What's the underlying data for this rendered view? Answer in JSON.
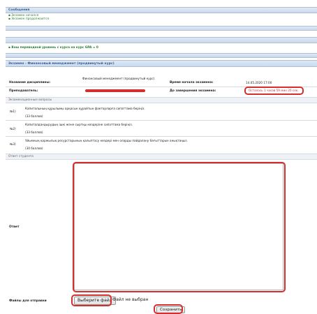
{
  "messages": {
    "title": "Сообщения",
    "items": [
      "Экзамен начался",
      "Экзамен продолжается"
    ]
  },
  "transfer": {
    "text": "Ваш переводной уровень с курса на курс GPA = 0"
  },
  "exam": {
    "title": "Экзамен - Финансовый менеджмент (продвинутый курс)",
    "discipline_label": "Название дисциплины:",
    "discipline_value": "Финансовый менеджмент (продвинутый курс)",
    "start_label": "Время начала экзамена:",
    "start_value": "14.05.2020 17:00",
    "teacher_label": "Преподаватель:",
    "remaining_label": "До завершения экзамена:",
    "remaining_value": "Осталось 1 часов 59 мин 20 сек.",
    "questions_title": "Экзаменационные вопросы",
    "questions": [
      {
        "num": "№1)",
        "text": "Капиталының құрылымы арқасын құрайтын факторларға сипаттама беріңіз.",
        "score": "(33 баллов)"
      },
      {
        "num": "№2)",
        "text": "Капиталдандырудың ішкі және сыртқы көздеріне сипаттама беріңіз.",
        "score": "(33 баллов)"
      },
      {
        "num": "№3)",
        "text": "Ұйымның қаржылық ресурстарының қалыптасу көздері мен оларды пайдалану бағыттарын анықтаңыз.",
        "score": "(34 баллов)"
      }
    ],
    "answer_title": "Ответ студента",
    "answer_label": "Ответ",
    "files_label": "Файлы для отправки",
    "choose_file": "Выберите файл",
    "no_file": "Файл не выбран",
    "save": "Сохранить"
  },
  "colors": {
    "accent": "#365f91",
    "message": "#2e7d32",
    "highlight": "#d32f2f"
  }
}
